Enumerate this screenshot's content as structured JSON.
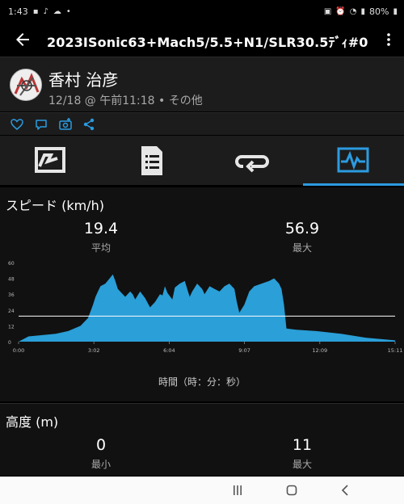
{
  "status": {
    "time": "1:43",
    "battery": "80%"
  },
  "appbar": {
    "title": "2023ISonic63+Mach5/5.5+N1/SLR30.5ﾃﾞｨ#0"
  },
  "profile": {
    "name": "香村 治彦",
    "meta": "12/18 @ 午前11:18 • その他"
  },
  "speed_section": {
    "title": "スピード (km/h)",
    "avg_value": "19.4",
    "avg_label": "平均",
    "max_value": "56.9",
    "max_label": "最大",
    "x_axis_label": "時間（時：分：秒）"
  },
  "altitude_section": {
    "title": "高度 (m)",
    "min_value": "0",
    "min_label": "最小",
    "max_value": "11",
    "max_label": "最大"
  },
  "colors": {
    "accent": "#2b9be0",
    "chart_fill": "#2a9fd8"
  },
  "chart_data": {
    "type": "area",
    "title": "",
    "xlabel": "時間（時：分：秒）",
    "ylabel": "",
    "yticks": [
      "0",
      "12",
      "24",
      "36",
      "48",
      "60"
    ],
    "ylim": [
      0,
      60
    ],
    "xticks": [
      "0:00",
      "3:02",
      "6:04",
      "9:07",
      "12:09",
      "15:11"
    ],
    "xlim_minutes": [
      0,
      15.18
    ],
    "average_line": 19.4,
    "series": [
      {
        "x_minutes": [
          0,
          0.4,
          1.0,
          1.5,
          2.0,
          2.5,
          2.8,
          3.0,
          3.1,
          3.2,
          3.3,
          3.5,
          3.8,
          3.9,
          4.0,
          4.3,
          4.5,
          4.6,
          4.7,
          4.9,
          5.1,
          5.3,
          5.5,
          5.7,
          5.8,
          5.9,
          6.0,
          6.2,
          6.3,
          6.5,
          6.7,
          6.8,
          6.9,
          7.0,
          7.2,
          7.4,
          7.5,
          7.7,
          7.9,
          8.1,
          8.3,
          8.5,
          8.7,
          8.8,
          8.9,
          9.1,
          9.3,
          9.5,
          9.8,
          10.1,
          10.3,
          10.5,
          10.6,
          10.7,
          10.8,
          11.2,
          12.0,
          13.0,
          14.0,
          15.18
        ],
        "y": [
          0,
          4,
          5,
          6,
          8,
          12,
          18,
          28,
          34,
          38,
          42,
          44,
          51,
          46,
          40,
          34,
          38,
          36,
          32,
          38,
          33,
          26,
          30,
          36,
          35,
          42,
          37,
          32,
          41,
          44,
          46,
          40,
          34,
          38,
          44,
          40,
          36,
          42,
          40,
          38,
          42,
          44,
          40,
          30,
          22,
          28,
          38,
          42,
          44,
          46,
          48,
          44,
          40,
          28,
          10,
          9,
          8,
          6,
          3,
          1
        ]
      }
    ]
  }
}
